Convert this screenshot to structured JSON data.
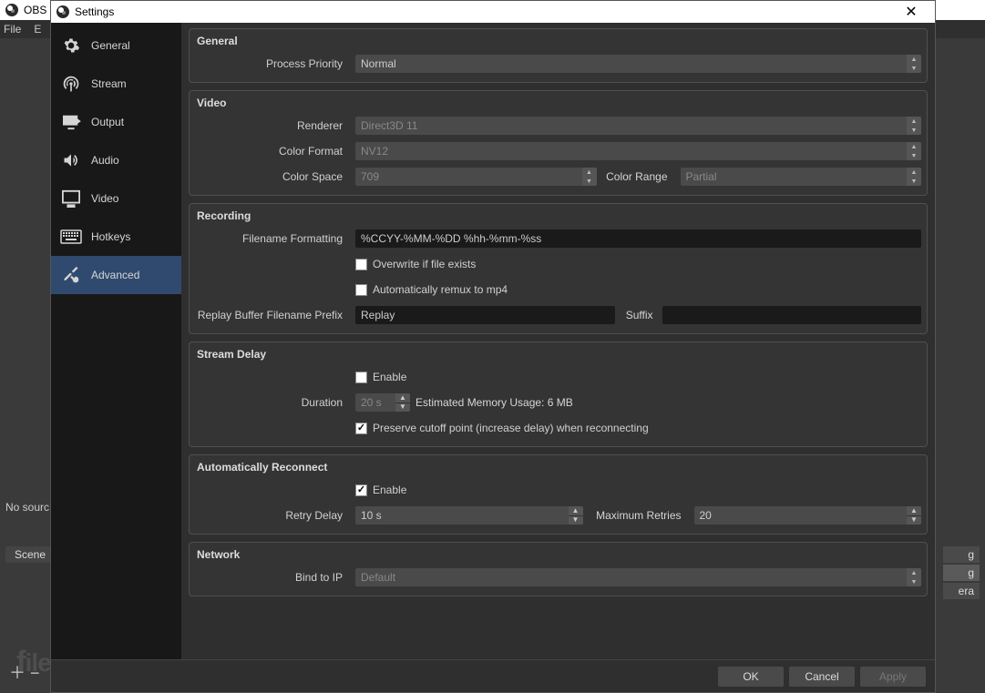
{
  "main_window": {
    "title_prefix": "OBS",
    "menu": {
      "file": "File",
      "edit": "E"
    },
    "no_sources": "No sourc",
    "scene": "Scene",
    "right_buttons": [
      "g",
      "g",
      "era"
    ]
  },
  "settings": {
    "title": "Settings",
    "sidebar": {
      "items": [
        {
          "label": "General"
        },
        {
          "label": "Stream"
        },
        {
          "label": "Output"
        },
        {
          "label": "Audio"
        },
        {
          "label": "Video"
        },
        {
          "label": "Hotkeys"
        },
        {
          "label": "Advanced"
        }
      ]
    },
    "sections": {
      "general": {
        "title": "General",
        "process_priority_label": "Process Priority",
        "process_priority_value": "Normal"
      },
      "video": {
        "title": "Video",
        "renderer_label": "Renderer",
        "renderer_value": "Direct3D 11",
        "color_format_label": "Color Format",
        "color_format_value": "NV12",
        "color_space_label": "Color Space",
        "color_space_value": "709",
        "color_range_label": "Color Range",
        "color_range_value": "Partial"
      },
      "recording": {
        "title": "Recording",
        "filename_formatting_label": "Filename Formatting",
        "filename_formatting_value": "%CCYY-%MM-%DD %hh-%mm-%ss",
        "overwrite_label": "Overwrite if file exists",
        "overwrite_checked": false,
        "remux_label": "Automatically remux to mp4",
        "remux_checked": false,
        "replay_prefix_label": "Replay Buffer Filename Prefix",
        "replay_prefix_value": "Replay",
        "suffix_label": "Suffix",
        "suffix_value": ""
      },
      "stream_delay": {
        "title": "Stream Delay",
        "enable_label": "Enable",
        "enable_checked": false,
        "duration_label": "Duration",
        "duration_value": "20 s",
        "estimated_label": "Estimated Memory Usage: 6 MB",
        "preserve_label": "Preserve cutoff point (increase delay) when reconnecting",
        "preserve_checked": true
      },
      "auto_reconnect": {
        "title": "Automatically Reconnect",
        "enable_label": "Enable",
        "enable_checked": true,
        "retry_delay_label": "Retry Delay",
        "retry_delay_value": "10 s",
        "max_retries_label": "Maximum Retries",
        "max_retries_value": "20"
      },
      "network": {
        "title": "Network",
        "bind_label": "Bind to IP",
        "bind_value": "Default"
      }
    },
    "footer": {
      "ok": "OK",
      "cancel": "Cancel",
      "apply": "Apply"
    }
  },
  "watermark": "filehorse.com"
}
